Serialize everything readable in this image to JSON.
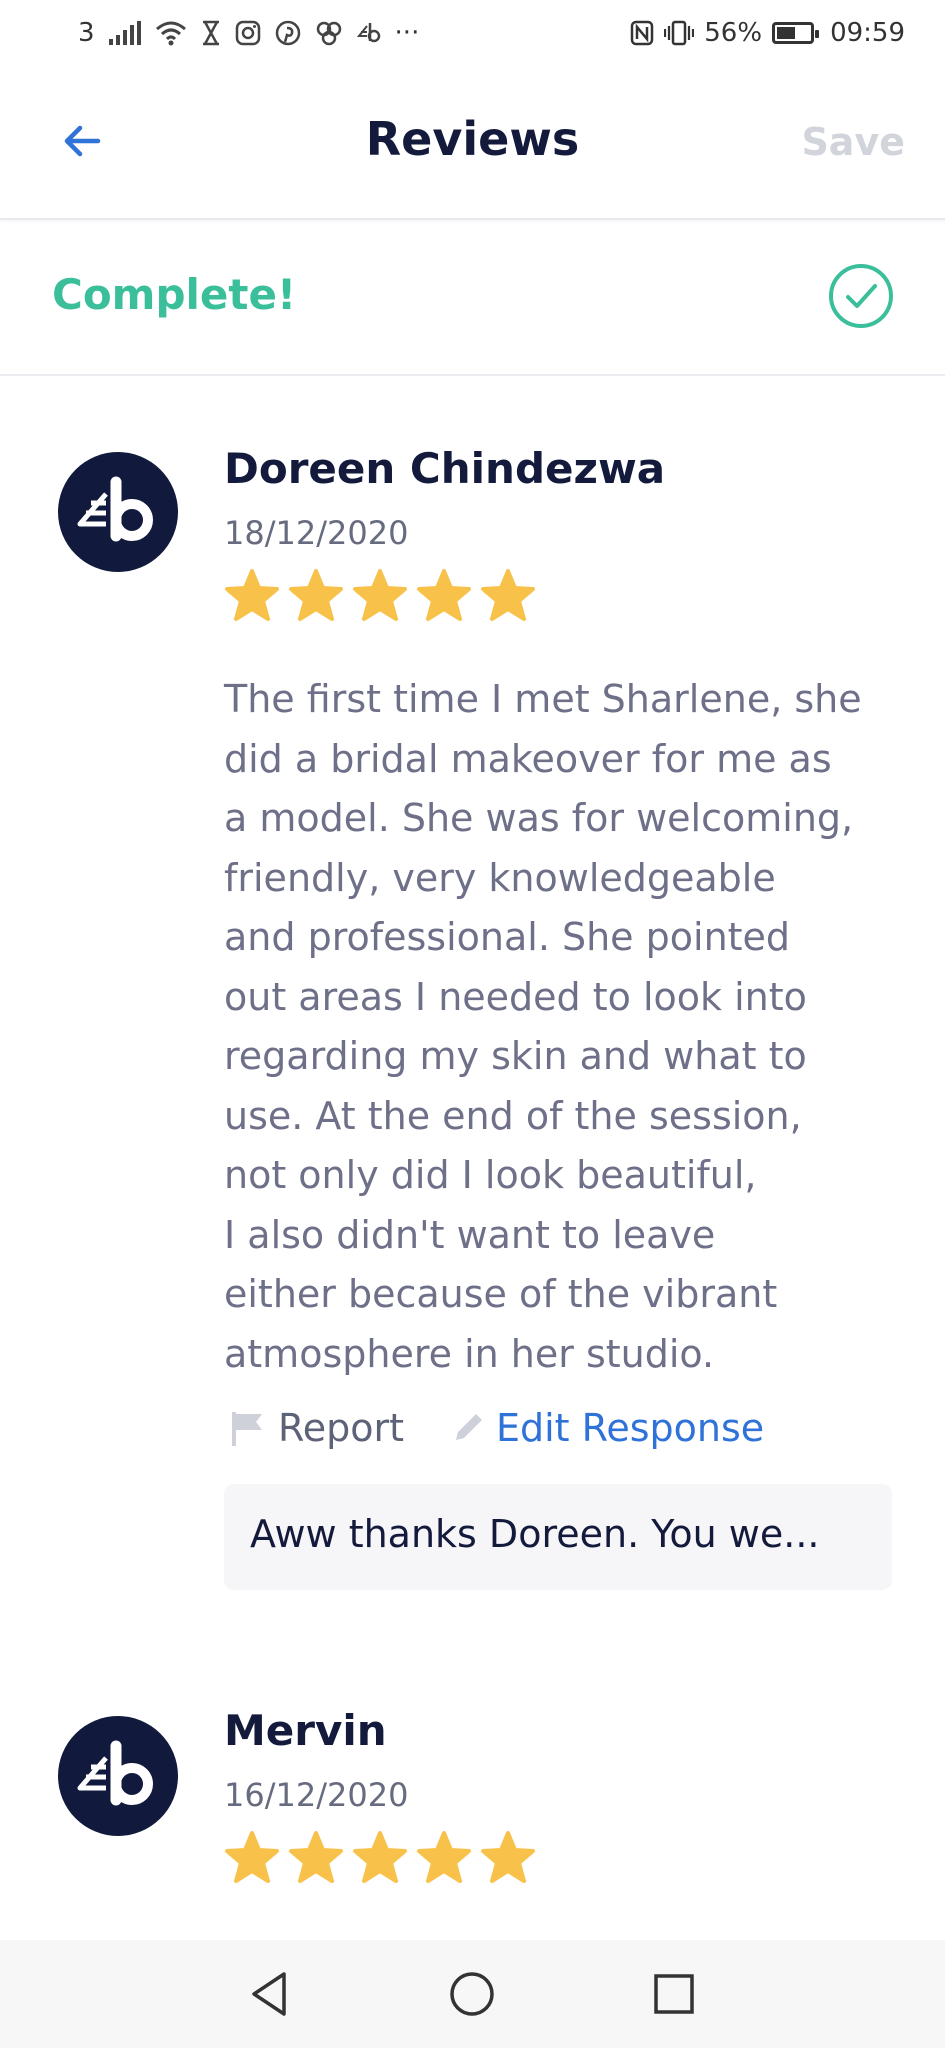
{
  "status_bar": {
    "carrier": "3",
    "battery_percent_text": "56%",
    "battery_level": 0.56,
    "time": "09:59",
    "more_indicator": "···",
    "icons": [
      "signal-icon",
      "wifi-icon",
      "hourglass-icon",
      "instagram-icon",
      "pinterest-icon",
      "apps-icon",
      "brand-icon",
      "nfc-icon",
      "vibrate-icon",
      "battery-icon"
    ]
  },
  "header": {
    "title": "Reviews",
    "save_label": "Save",
    "back_icon": "arrow-left-icon"
  },
  "status_row": {
    "label": "Complete!",
    "icon": "check-circle-icon",
    "color": "#3bbf9b"
  },
  "reviews": [
    {
      "name": "Doreen Chindezwa",
      "date": "18/12/2020",
      "rating": 5,
      "lines": [
        "The first time I met Sharlene, she",
        "did a bridal makeover for me as",
        "a model. She was for welcoming,",
        "friendly, very knowledgeable",
        "and professional. She pointed",
        "out areas I needed to look into",
        "regarding my skin and what to",
        "use. At the end of the session,",
        "not only did I look beautiful,",
        "I also didn't want to leave",
        "either because of the vibrant",
        "atmosphere in her studio."
      ],
      "report_label": "Report",
      "edit_response_label": "Edit Response",
      "response_preview": "Aww thanks Doreen. You we..."
    },
    {
      "name": "Mervin",
      "date": "16/12/2020",
      "rating": 5
    }
  ],
  "colors": {
    "accent_blue": "#2f72d8",
    "success_green": "#3bbf9b",
    "star_gold": "#f8c14a",
    "avatar_navy": "#111a3d"
  },
  "nav_bar": {
    "back_icon": "triangle-back-icon",
    "home_icon": "circle-home-icon",
    "recents_icon": "square-recents-icon"
  }
}
